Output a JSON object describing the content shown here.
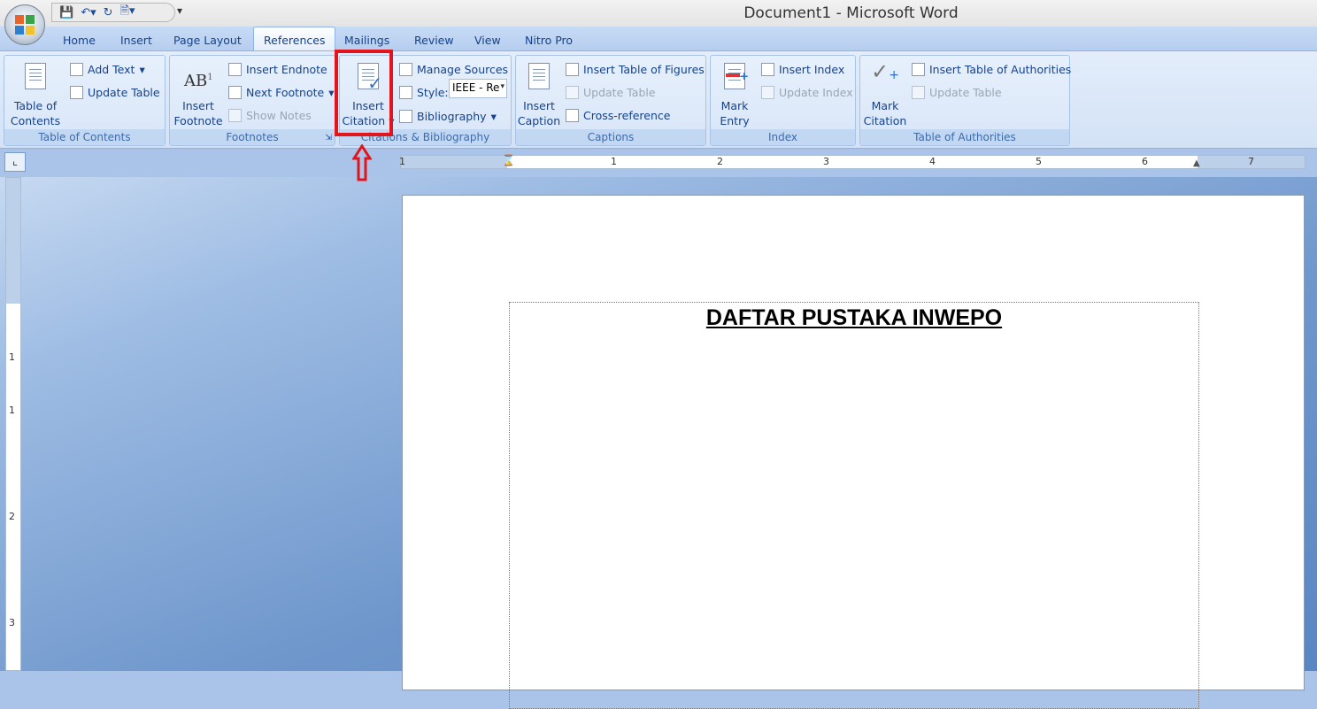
{
  "window": {
    "title": "Document1 - Microsoft Word"
  },
  "tabs": [
    {
      "label": "Home"
    },
    {
      "label": "Insert"
    },
    {
      "label": "Page Layout"
    },
    {
      "label": "References"
    },
    {
      "label": "Mailings"
    },
    {
      "label": "Review"
    },
    {
      "label": "View"
    },
    {
      "label": "Nitro Pro"
    }
  ],
  "ribbon": {
    "toc": {
      "big": "Table of Contents",
      "big1": "Table of",
      "big2": "Contents",
      "add_text": "Add Text",
      "update_table": "Update Table",
      "label": "Table of Contents"
    },
    "footnotes": {
      "big1": "Insert",
      "big2": "Footnote",
      "ab": "AB",
      "insert_endnote": "Insert Endnote",
      "next_footnote": "Next Footnote",
      "show_notes": "Show Notes",
      "label": "Footnotes"
    },
    "citations": {
      "big1": "Insert",
      "big2": "Citation",
      "manage_sources": "Manage Sources",
      "style_label": "Style:",
      "style_value": "IEEE - Re",
      "bibliography": "Bibliography",
      "label": "Citations & Bibliography"
    },
    "captions": {
      "big1": "Insert",
      "big2": "Caption",
      "insert_tof": "Insert Table of Figures",
      "update_table": "Update Table",
      "cross_reference": "Cross-reference",
      "label": "Captions"
    },
    "index": {
      "big1": "Mark",
      "big2": "Entry",
      "insert_index": "Insert Index",
      "update_index": "Update Index",
      "label": "Index"
    },
    "toa": {
      "big1": "Mark",
      "big2": "Citation",
      "insert_toa": "Insert Table of Authorities",
      "update_table": "Update Table",
      "label": "Table of Authorities"
    }
  },
  "ruler": {
    "numbers": [
      "1",
      "1",
      "2",
      "3",
      "4",
      "5",
      "6",
      "7"
    ]
  },
  "vruler": {
    "numbers": [
      "1",
      "1",
      "2",
      "3"
    ]
  },
  "document": {
    "title": "DAFTAR PUSTAKA INWEPO"
  },
  "annotation_color": "#e3141b"
}
